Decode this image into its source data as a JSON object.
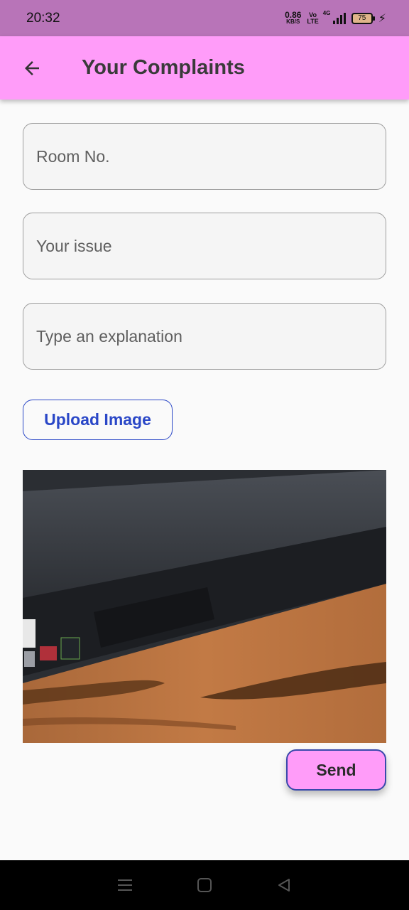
{
  "status_bar": {
    "time": "20:32",
    "net_speed_value": "0.86",
    "net_speed_unit": "KB/S",
    "volte_top": "Vo",
    "volte_bottom": "LTE",
    "network_gen": "4G",
    "battery_level": "75"
  },
  "app_bar": {
    "title": "Your Complaints",
    "back_icon": "arrow-left-icon"
  },
  "form": {
    "room_placeholder": "Room No.",
    "issue_placeholder": "Your issue",
    "explanation_placeholder": "Type an explanation",
    "upload_label": "Upload Image",
    "send_label": "Send"
  },
  "preview": {
    "icon": "uploaded-photo"
  },
  "nav_bar": {
    "icons": [
      "menu-icon",
      "home-icon",
      "back-icon"
    ]
  },
  "colors": {
    "status_bar": "#b874b8",
    "app_bar": "#ff9cf9",
    "accent_blue": "#2a47c7",
    "send_border": "#3949ab"
  }
}
